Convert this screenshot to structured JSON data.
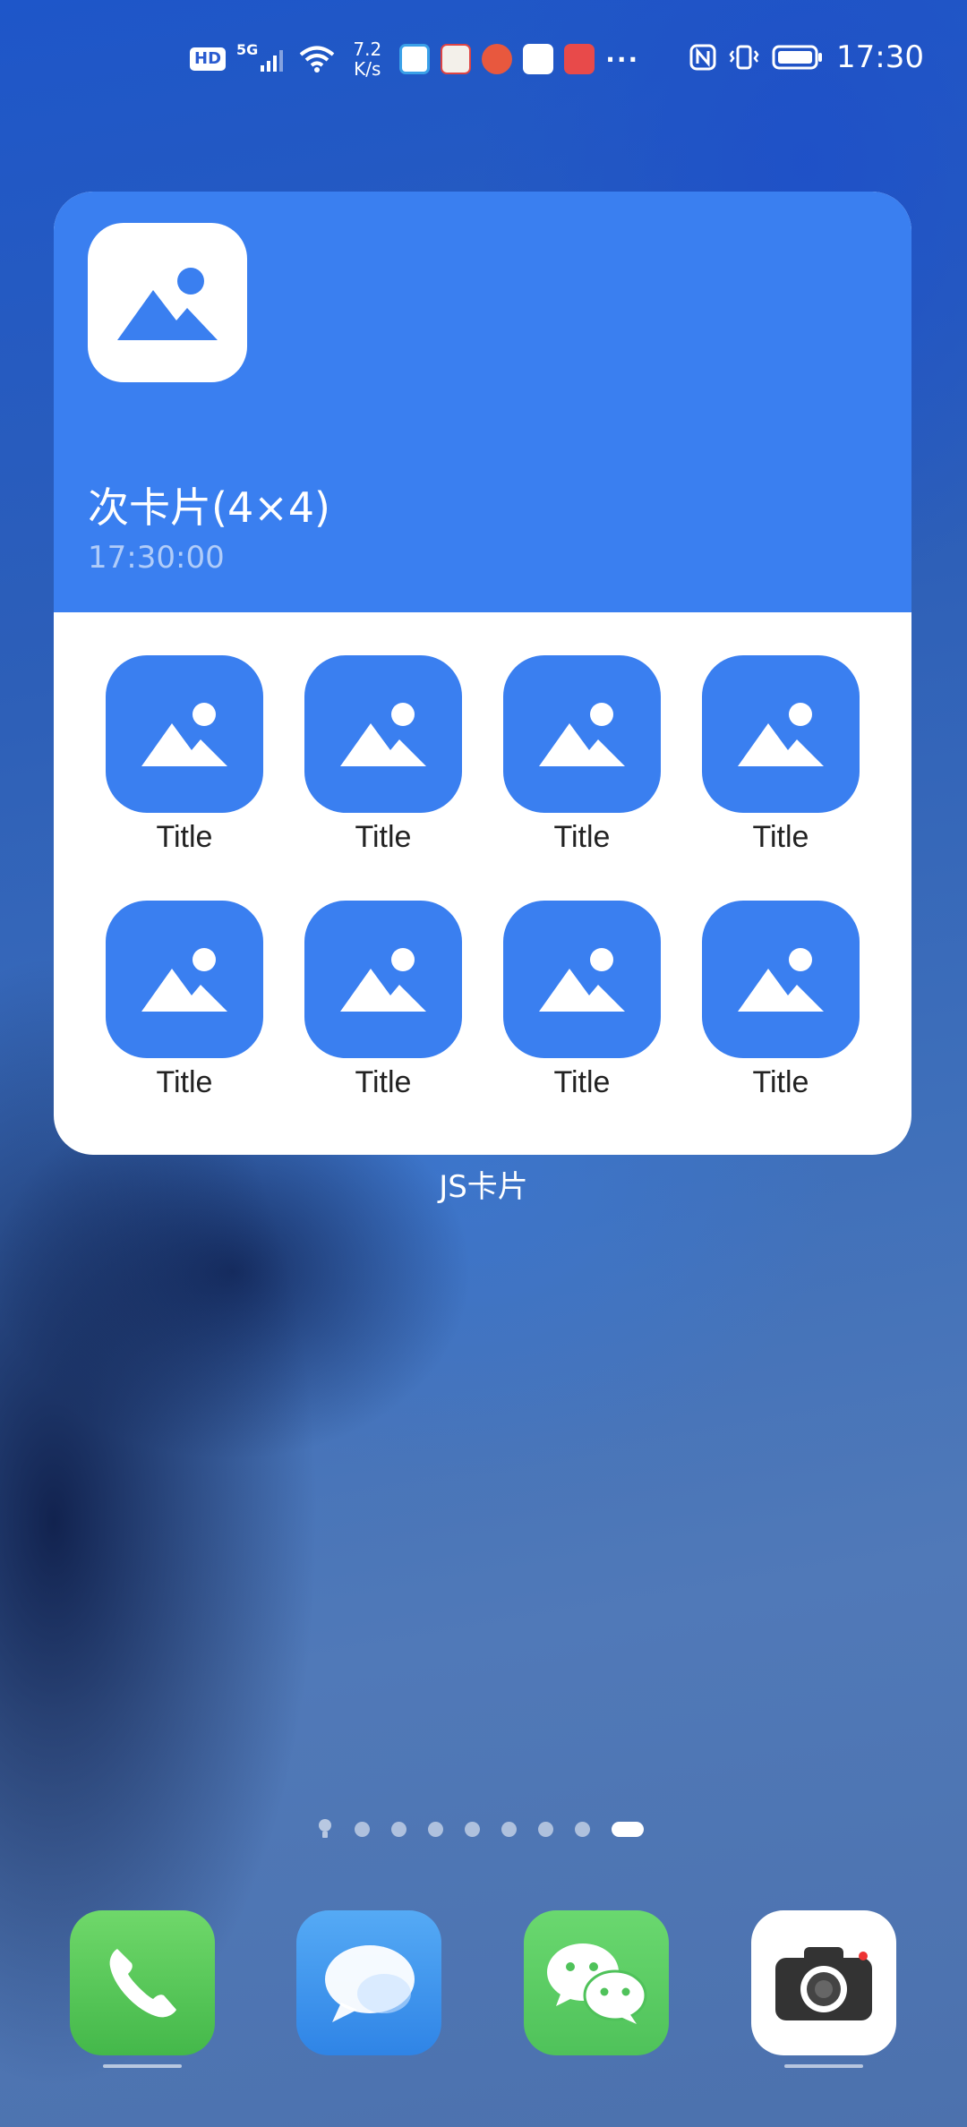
{
  "statusbar": {
    "hd": "HD",
    "network": "5G",
    "speed_value": "7.2",
    "speed_unit": "K/s",
    "more": "···",
    "time": "17:30"
  },
  "widget": {
    "title": "次卡片(4×4)",
    "time": "17:30:00",
    "caption": "JS卡片",
    "items": [
      {
        "label": "Title"
      },
      {
        "label": "Title"
      },
      {
        "label": "Title"
      },
      {
        "label": "Title"
      },
      {
        "label": "Title"
      },
      {
        "label": "Title"
      },
      {
        "label": "Title"
      },
      {
        "label": "Title"
      }
    ]
  },
  "pager": {
    "pages": 8,
    "active_index": 7
  },
  "dock": [
    "phone-icon",
    "messages-icon",
    "wechat-icon",
    "camera-icon"
  ],
  "colors": {
    "accent": "#3a7ff0",
    "phone": "#5ccc5a",
    "messages": "#3f9cf0",
    "wechat": "#5fd068",
    "camera_bg": "#ffffff"
  }
}
